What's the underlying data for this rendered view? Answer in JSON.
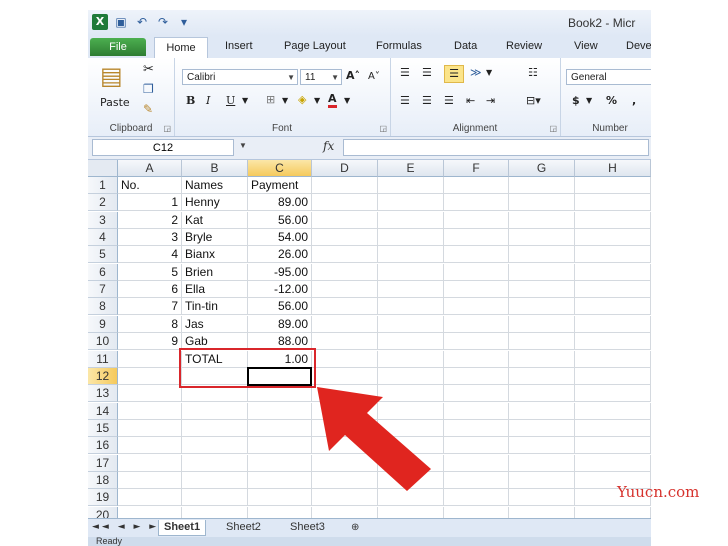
{
  "title_bar": {
    "title": "Book2 - Micr"
  },
  "ribbon_tabs": [
    "File",
    "Home",
    "Insert",
    "Page Layout",
    "Formulas",
    "Data",
    "Review",
    "View",
    "Deve"
  ],
  "ribbon": {
    "clipboard": {
      "paste_label": "Paste",
      "group_label": "Clipboard"
    },
    "font": {
      "name": "Calibri",
      "size": "11",
      "bold": "B",
      "italic": "I",
      "underline": "U",
      "group_label": "Font"
    },
    "alignment": {
      "group_label": "Alignment"
    },
    "number": {
      "format": "General",
      "currency": "$",
      "percent": "%",
      "comma": ",",
      "group_label": "Number"
    }
  },
  "formula_bar": {
    "name_box": "C12",
    "fx": "fx",
    "content": ""
  },
  "columns": [
    "A",
    "B",
    "C",
    "D",
    "E",
    "F",
    "G",
    "H"
  ],
  "rows": [
    {
      "n": "1",
      "a": "No.",
      "b": "Names",
      "c": "Payment"
    },
    {
      "n": "2",
      "a": "1",
      "b": "Henny",
      "c": "89.00"
    },
    {
      "n": "3",
      "a": "2",
      "b": "Kat",
      "c": "56.00"
    },
    {
      "n": "4",
      "a": "3",
      "b": "Bryle",
      "c": "54.00"
    },
    {
      "n": "5",
      "a": "4",
      "b": "Bianx",
      "c": "26.00"
    },
    {
      "n": "6",
      "a": "5",
      "b": "Brien",
      "c": "-95.00"
    },
    {
      "n": "7",
      "a": "6",
      "b": "Ella",
      "c": "-12.00"
    },
    {
      "n": "8",
      "a": "7",
      "b": "Tin-tin",
      "c": "56.00"
    },
    {
      "n": "9",
      "a": "8",
      "b": "Jas",
      "c": "89.00"
    },
    {
      "n": "10",
      "a": "9",
      "b": "Gab",
      "c": "88.00"
    },
    {
      "n": "11",
      "a": "",
      "b": "TOTAL",
      "c": "1.00"
    },
    {
      "n": "12",
      "a": "",
      "b": "",
      "c": ""
    },
    {
      "n": "13",
      "a": "",
      "b": "",
      "c": ""
    },
    {
      "n": "14",
      "a": "",
      "b": "",
      "c": ""
    },
    {
      "n": "15",
      "a": "",
      "b": "",
      "c": ""
    },
    {
      "n": "16",
      "a": "",
      "b": "",
      "c": ""
    },
    {
      "n": "17",
      "a": "",
      "b": "",
      "c": ""
    },
    {
      "n": "18",
      "a": "",
      "b": "",
      "c": ""
    },
    {
      "n": "19",
      "a": "",
      "b": "",
      "c": ""
    },
    {
      "n": "20",
      "a": "",
      "b": "",
      "c": ""
    }
  ],
  "sheet_tabs": [
    "Sheet1",
    "Sheet2",
    "Sheet3"
  ],
  "status": {
    "text": "Ready"
  },
  "watermark": "Yuucn.com",
  "colors": {
    "highlight": "#d9262b",
    "arrow": "#e0251f",
    "file_tab": "#2e7d32"
  }
}
